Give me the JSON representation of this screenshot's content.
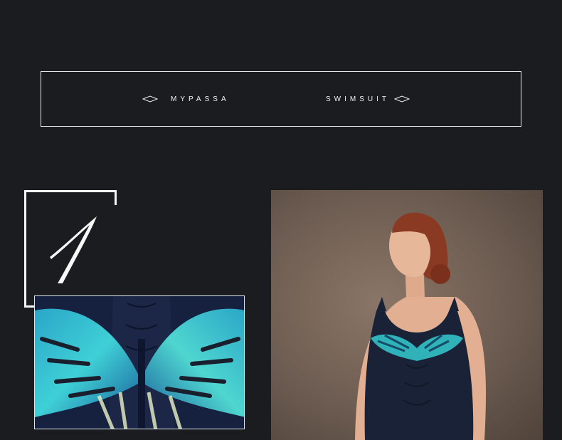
{
  "banner": {
    "left_label": "MYPASSA",
    "right_label": "SWIMSUIT"
  },
  "feature": {
    "number_label": "1"
  },
  "images": {
    "detail": "fabric-closeup-feather-print",
    "model": "model-wearing-navy-swimsuit"
  },
  "colors": {
    "background": "#1b1c1f",
    "frame": "#f5f5f5",
    "swimsuit_navy": "#1a2238",
    "print_teal": "#2fb2b8",
    "print_blue": "#2a79c4",
    "hair": "#8a3a22",
    "skin": "#e7b79a",
    "photo_backdrop": "#6d5c51"
  }
}
